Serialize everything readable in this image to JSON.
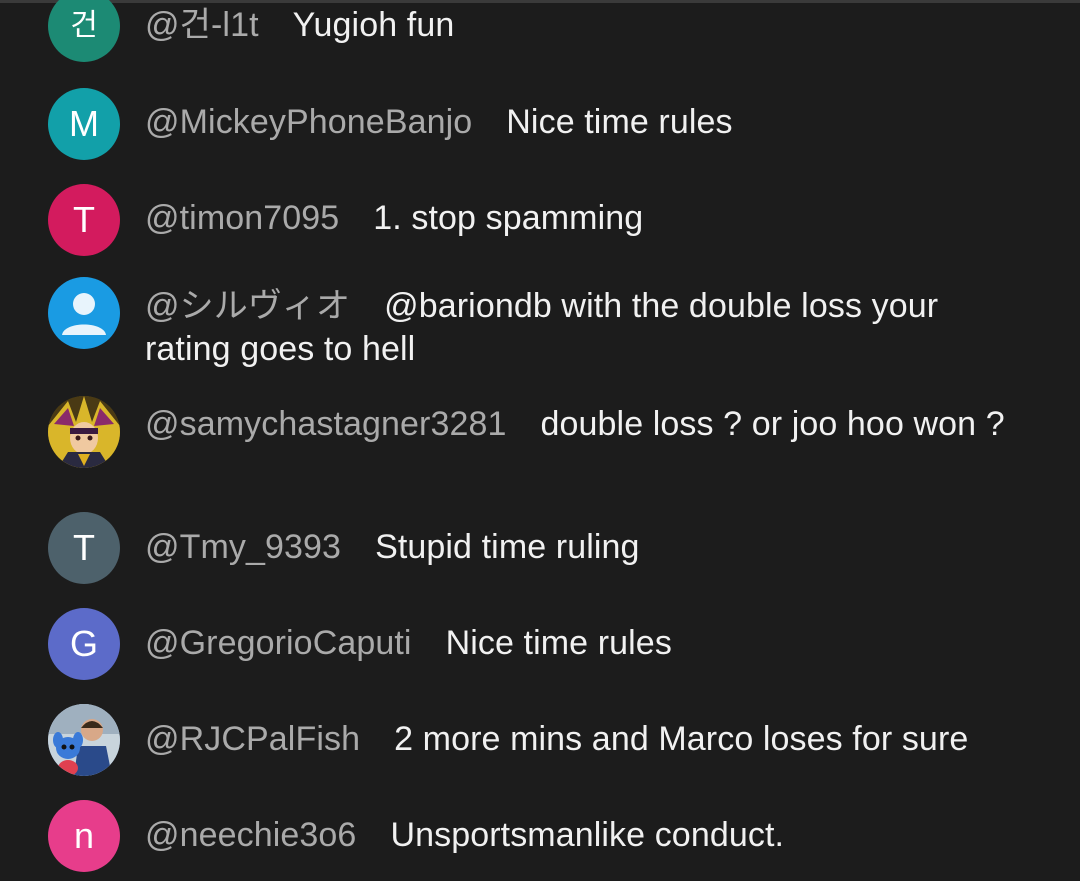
{
  "messages": [
    {
      "author": "@건-l1t",
      "text": "Yugioh fun",
      "avatar": {
        "letter": "건",
        "color": "#1c8a74",
        "type": "letter"
      }
    },
    {
      "author": "@MickeyPhoneBanjo",
      "text": "Nice time rules",
      "avatar": {
        "letter": "M",
        "color": "#12a0a9",
        "type": "letter"
      }
    },
    {
      "author": "@timon7095",
      "text": "1. stop spamming",
      "avatar": {
        "letter": "T",
        "color": "#d31b5e",
        "type": "letter"
      }
    },
    {
      "author": "@シルヴィオ",
      "text": "@bariondb with the double loss your rating goes to hell",
      "avatar": {
        "letter": "",
        "color": "#1a9be3",
        "type": "default-person"
      }
    },
    {
      "author": "@samychastagner3281",
      "text": "double loss ? or joo hoo won ?",
      "avatar": {
        "letter": "",
        "color": "#6b5a1a",
        "type": "photo"
      }
    },
    {
      "author": "@Tmy_9393",
      "text": "Stupid time ruling",
      "avatar": {
        "letter": "T",
        "color": "#4d616b",
        "type": "letter"
      }
    },
    {
      "author": "@GregorioCaputi",
      "text": "Nice time rules",
      "avatar": {
        "letter": "G",
        "color": "#5c6bc9",
        "type": "letter"
      }
    },
    {
      "author": "@RJCPalFish",
      "text": "2 more mins and Marco loses for sure",
      "avatar": {
        "letter": "",
        "color": "#4a6fa8",
        "type": "photo"
      }
    },
    {
      "author": "@neechie3o6",
      "text": "Unsportsmanlike conduct.",
      "avatar": {
        "letter": "n",
        "color": "#e73d8b",
        "type": "letter"
      }
    }
  ]
}
